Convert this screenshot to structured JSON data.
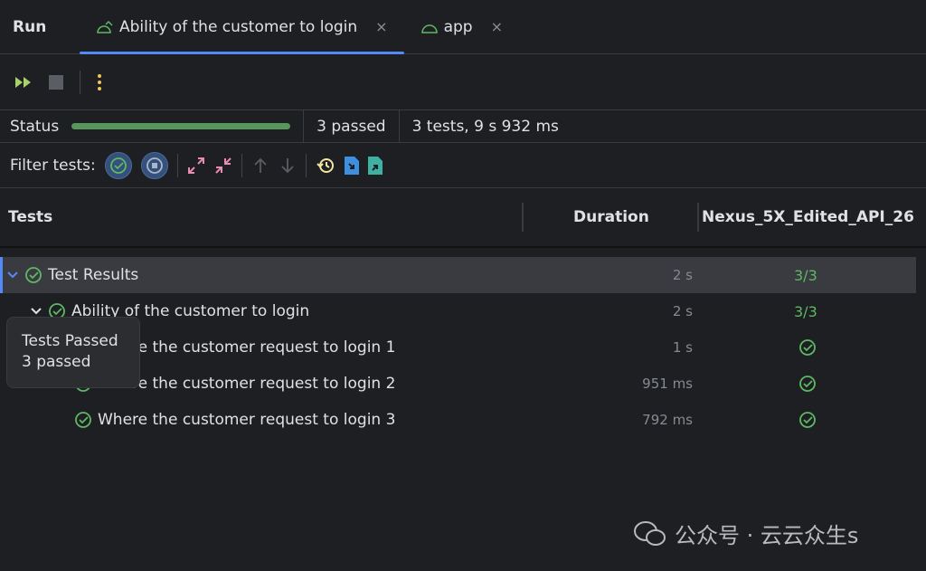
{
  "tabs": {
    "run_label": "Run",
    "items": [
      {
        "label": "Ability of the customer to login",
        "active": true
      },
      {
        "label": "app",
        "active": false
      }
    ],
    "close_glyph": "×"
  },
  "toolbar": {
    "icons": [
      "rerun-icon",
      "stop-icon",
      "more-icon"
    ]
  },
  "status": {
    "label": "Status",
    "progress_percent": 100,
    "passed": "3 passed",
    "summary": "3 tests, 9 s 932 ms"
  },
  "filter": {
    "label": "Filter tests:"
  },
  "columns": {
    "tests": "Tests",
    "duration": "Duration",
    "device": "Nexus_5X_Edited_API_26"
  },
  "rows": [
    {
      "name": "Test Results",
      "duration": "2 s",
      "result": "3/3",
      "level": 0,
      "expanded": true,
      "selected": true
    },
    {
      "name": "Ability of the customer to login",
      "duration": "2 s",
      "result": "3/3",
      "level": 1,
      "expanded": true
    },
    {
      "name": "Where the customer request to login 1",
      "duration": "1 s",
      "result": "passed",
      "level": 2
    },
    {
      "name": "Where the customer request to login 2",
      "duration": "951 ms",
      "result": "passed",
      "level": 2
    },
    {
      "name": "Where the customer request to login 3",
      "duration": "792 ms",
      "result": "passed",
      "level": 2
    }
  ],
  "tooltip": {
    "title": "Tests Passed",
    "detail": "3 passed"
  },
  "watermark": {
    "text": "公众号 · 云云众生s"
  },
  "colors": {
    "accent": "#548af7",
    "pass": "#5fb865",
    "progress": "#57965c"
  }
}
